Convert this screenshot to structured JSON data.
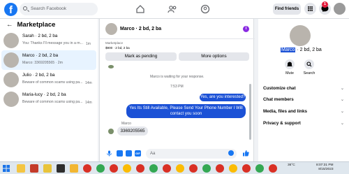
{
  "topbar": {
    "logo": "f",
    "search_placeholder": "Search Facebook",
    "find_friends": "Find friends",
    "notification_count": "1"
  },
  "sidebar": {
    "title": "Marketplace",
    "threads": [
      {
        "name": "Sarah · 2 bd, 2 ba",
        "preview": "You: Thanks I'll message you in a m...",
        "time": "1m"
      },
      {
        "name": "Marco · 2 bd, 2 ba",
        "preview": "Marco: 3369205565 · 2m",
        "time": ""
      },
      {
        "name": "Julio · 2 bd, 2 ba",
        "preview": "Beware of common scams using pa...",
        "time": "14m"
      },
      {
        "name": "Maria-lucy · 2 bd, 2 ba",
        "preview": "Beware of common scams using pa...",
        "time": "14m"
      }
    ]
  },
  "chat": {
    "title": "Marco · 2 bd, 2 ba",
    "listing_source": "Marketplace",
    "listing_detail": "$900 · 2 bd, 2 ba",
    "mark_pending": "Mark as pending",
    "more_options": "More options",
    "waiting_note": "Marco is waiting for your response.",
    "timestamp": "7:53 PM",
    "out_msg_1": "Yes, are you interested?",
    "out_msg_2": "Yes Its Still Available, Please Send Your Phone Number I Will contact you soon",
    "sender_label": "Marco",
    "in_msg": "3369205565",
    "composer_placeholder": "Aa"
  },
  "profile": {
    "name_highlight": "Marco",
    "name_rest": "· 2 bd, 2 ba",
    "actions": [
      "Mute",
      "Search"
    ],
    "sections": [
      "Customize chat",
      "Chat members",
      "Media, files and links",
      "Privacy & support"
    ]
  },
  "taskbar": {
    "temperature": "36°C",
    "time": "8:07:31 PM",
    "date": "8/15/2023"
  },
  "colors": {
    "brand": "#1877f2",
    "outgoing_bubble": "#1b51d6",
    "badge": "#e41e3f",
    "info_icon": "#8a2be2"
  }
}
